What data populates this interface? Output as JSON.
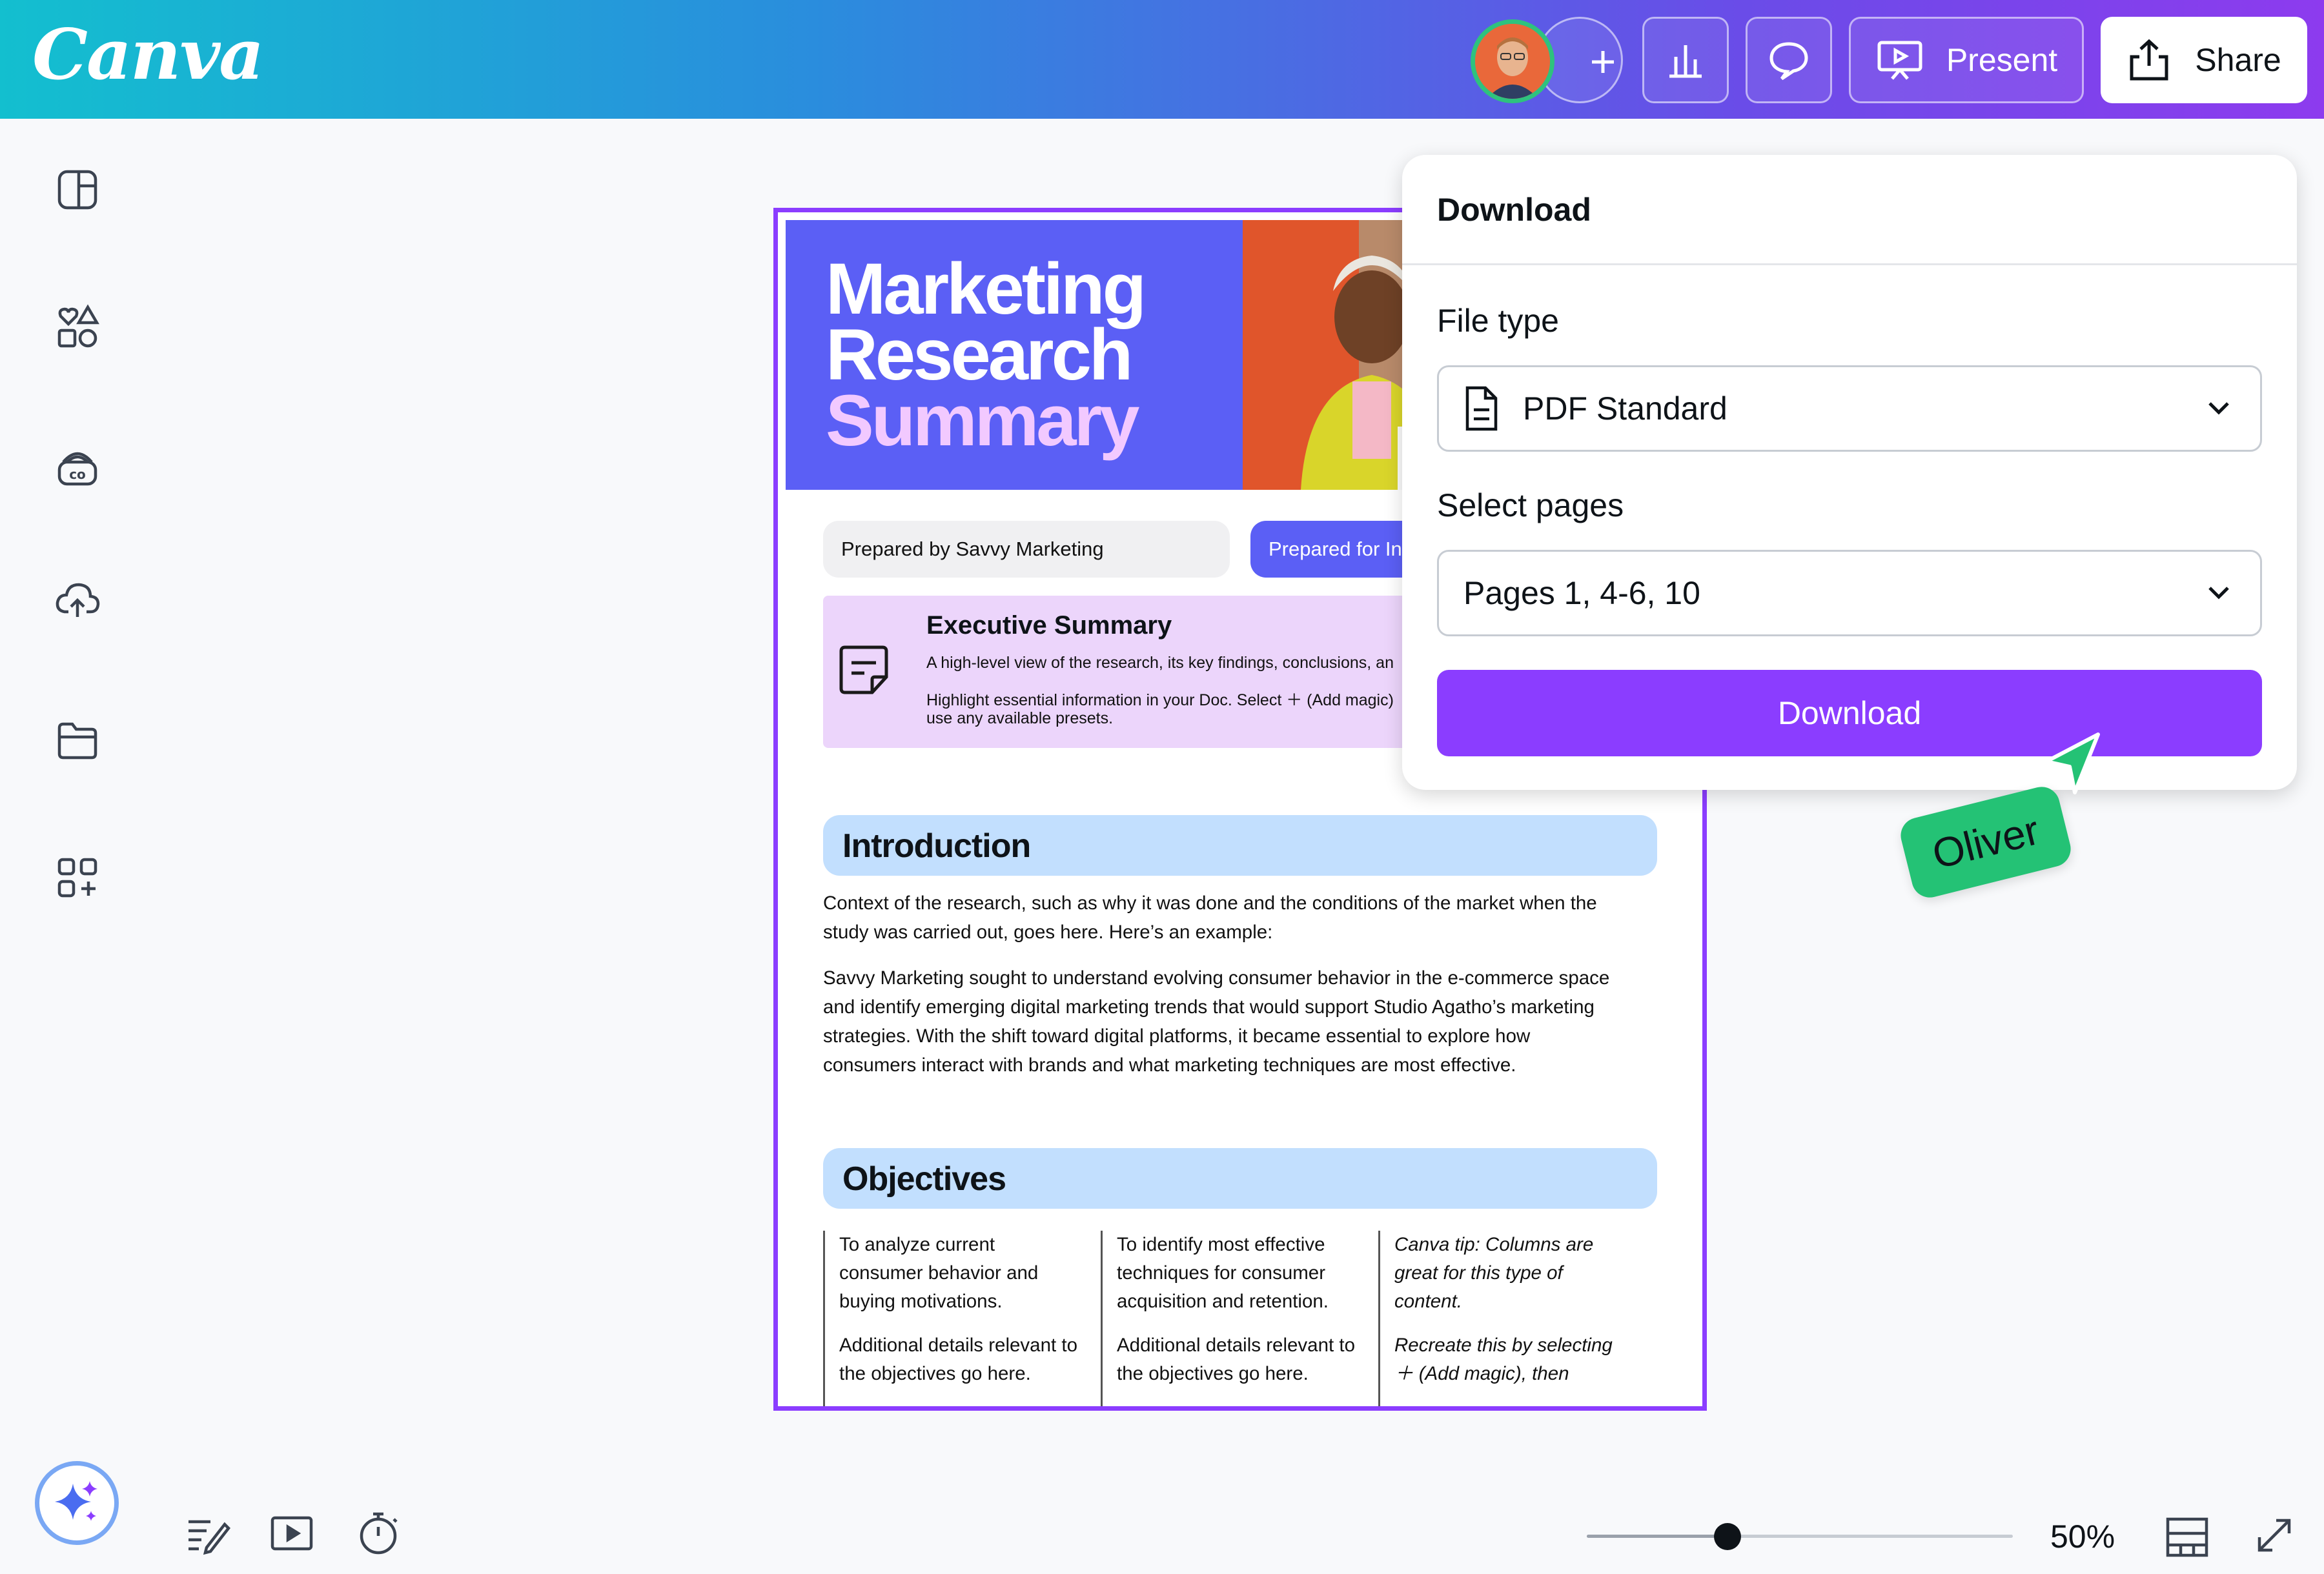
{
  "header": {
    "logo": "Canva",
    "present_label": "Present",
    "share_label": "Share"
  },
  "document": {
    "title_lines": [
      "Marketing",
      "Research",
      "Summary"
    ],
    "prepared_by": "Prepared by Savvy Marketing",
    "prepared_for": "Prepared for Inn",
    "exec_summary": {
      "title": "Executive Summary",
      "line1": "A high-level view of the research, its key findings, conclusions, an",
      "line2": "Highlight essential information in your Doc.  Select ＋ (Add magic)",
      "line3": "use any available presets."
    },
    "introduction": {
      "title": "Introduction",
      "para1_line1": "Context of the research, such as why it was done and the conditions of the market when the",
      "para1_line2": "study was carried out, goes here. Here’s an example:",
      "para2_lines": [
        "Savvy Marketing sought to understand evolving consumer behavior in the e-commerce space",
        "and identify emerging digital marketing trends that would support Studio Agatho’s marketing",
        "strategies. With the shift toward digital platforms, it became essential to explore how",
        "consumers interact with brands and what marketing techniques are most effective."
      ]
    },
    "objectives": {
      "title": "Objectives",
      "columns": [
        {
          "lines": [
            "To analyze current",
            "consumer behavior and",
            "buying motivations."
          ],
          "extra": [
            "Additional details relevant to",
            "the objectives go here."
          ]
        },
        {
          "lines": [
            "To identify most effective",
            "techniques for consumer",
            "acquisition and retention."
          ],
          "extra": [
            "Additional details relevant to",
            "the objectives go here."
          ]
        },
        {
          "lines": [
            "Canva tip: Columns are",
            "great for this type of",
            "content."
          ],
          "extra": [
            "Recreate this by selecting",
            "＋ (Add magic), then"
          ]
        }
      ]
    }
  },
  "download_panel": {
    "title": "Download",
    "file_type_label": "File type",
    "file_type_value": "PDF Standard",
    "select_pages_label": "Select pages",
    "select_pages_value": "Pages 1, 4-6, 10",
    "download_button": "Download"
  },
  "collaborator": {
    "cursor_name": "Oliver"
  },
  "footer": {
    "zoom_label": "50%",
    "zoom_fraction": 0.33
  },
  "colors": {
    "accent": "#8b3dff",
    "doc_blue": "#5b5ff5",
    "section_band": "#c2dffe",
    "exec_box": "#ecd5fb",
    "cursor_green": "#24c275"
  }
}
